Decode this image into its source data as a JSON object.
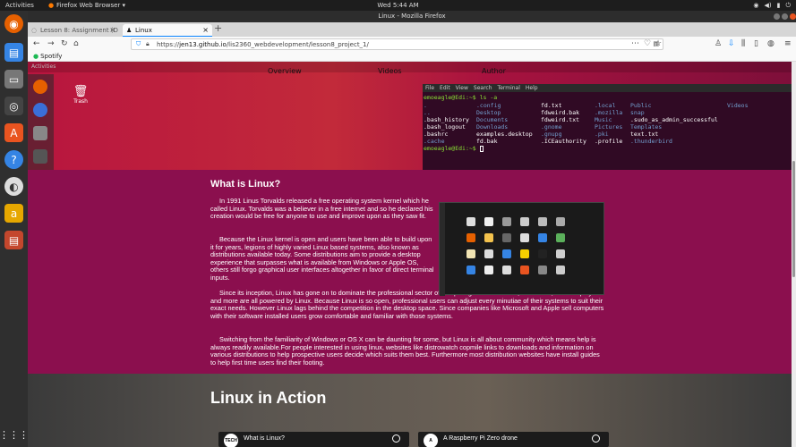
{
  "top_panel": {
    "activities": "Activities",
    "app_menu": "Firefox Web Browser ▾",
    "clock": "Wed  5:44 AM"
  },
  "window": {
    "title": "Linux - Mozilla Firefox"
  },
  "tabs": [
    {
      "label": "Lesson 8: Assignment (D"
    },
    {
      "label": "Linux"
    }
  ],
  "url": {
    "prefix": "https://",
    "host": "jen13.github.io",
    "path": "/lis2360_webdevelopment/lesson8_project_1/"
  },
  "bookmarks": [
    {
      "label": "Spotify"
    }
  ],
  "hero": {
    "activities": "Activities",
    "nav": [
      "Overview",
      "Videos",
      "Author"
    ],
    "trash_label": "Trash",
    "terminal_menu": [
      "File",
      "Edit",
      "View",
      "Search",
      "Terminal",
      "Help"
    ],
    "terminal_prompt_1": "emoeagle@Edi:~$ ls -a",
    "terminal_prompt_2": "emoeagle@Edi:~$ "
  },
  "article": {
    "title": "What is Linux?",
    "paragraphs": [
      "In 1991 Linus Torvalds released a free operating system kernel which he called Linux. Torvalds was a believer in a free internet and so he declared his creation would be free for anyone to use and improve upon as they saw fit.",
      "Because the Linux kernel is open and users have been able to build upon it for years, legions of highly varied Linux based systems, also known as distributions available today. Some distributions aim to provide a desktop experience that surpasses what is available from Windows or Apple OS, others still forgo graphical user interfaces altogether in favor of direct terminal inputs.",
      "Since its inception, Linux has gone on to dominate the professional sector of computing needs. Servers, databases, kiosk displays and more are all powered by Linux. Because Linux is so open, professional users can adjust every minutiae of their systems to suit their exact needs. However Linux lags behind the competition in the desktop space. Since companies like Microsoft and Apple sell computers with their software installed users grow comfortable and familiar with those systems.",
      "Switching from the familiarity of Windows or OS X can be daunting for some, but Linux is all about community which means help is always readily available.For people interested in using linux, websites like distrowatch copmile links to downloads and information on various distributions to help prospective users decide which suits them best. Furthermore most distribution websites have install guides to help first time users find their footing."
    ]
  },
  "action": {
    "title": "Linux in Action",
    "videos": [
      {
        "title": "What is Linux?",
        "channel": "TECH"
      },
      {
        "title": "A Raspberry Pi Zero drone",
        "channel": "A"
      }
    ]
  },
  "colors": {
    "page_bg": "#8b0f4e",
    "hero_red": "#c22a3a",
    "terminal_bg": "#300a24",
    "accent": "#0a84ff"
  }
}
